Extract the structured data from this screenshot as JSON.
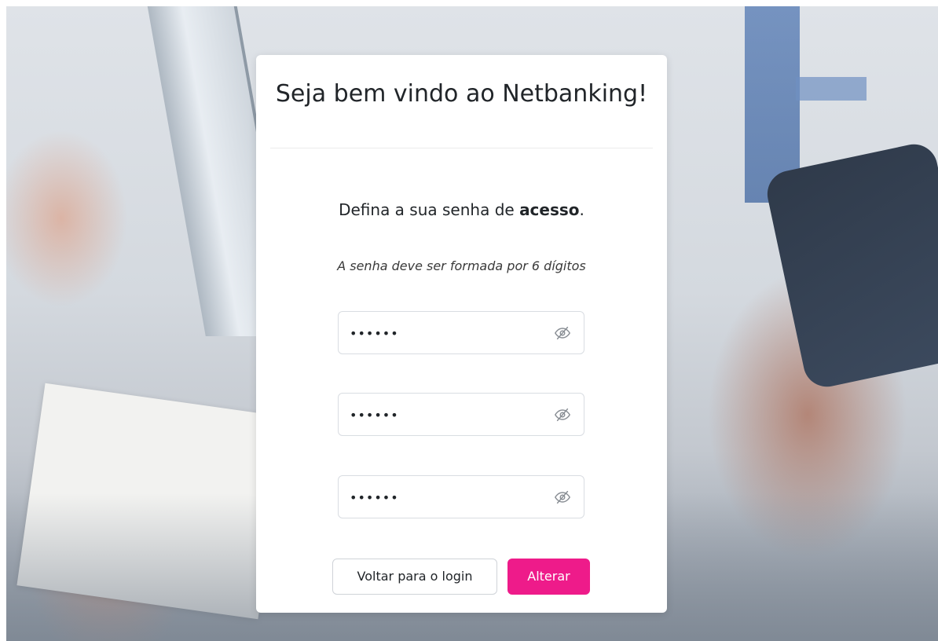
{
  "card": {
    "title": "Seja bem vindo ao Netbanking!",
    "subtitle_prefix": "Defina a sua senha de ",
    "subtitle_bold": "acesso",
    "subtitle_suffix": ".",
    "hint": "A senha deve ser formada por 6 dígitos"
  },
  "fields": [
    {
      "value": "••••••",
      "icon": "eye-slash-icon"
    },
    {
      "value": "••••••",
      "icon": "eye-slash-icon"
    },
    {
      "value": "••••••",
      "icon": "eye-slash-icon"
    }
  ],
  "buttons": {
    "back_label": "Voltar para o login",
    "change_label": "Alterar"
  },
  "colors": {
    "accent": "#ee1b8a",
    "text": "#212529",
    "card_bg": "#ffffff",
    "field_border": "#d9dde2"
  }
}
